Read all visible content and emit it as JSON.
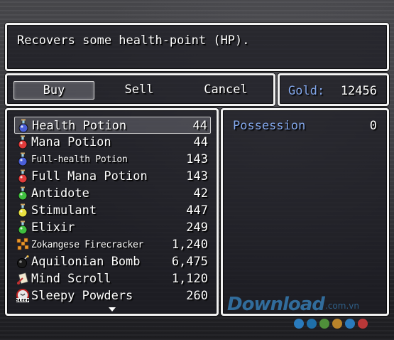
{
  "help": {
    "text": "Recovers some health-point (HP)."
  },
  "commands": [
    {
      "label": "Buy",
      "selected": true
    },
    {
      "label": "Sell",
      "selected": false
    },
    {
      "label": "Cancel",
      "selected": false
    }
  ],
  "gold": {
    "label": "Gold:",
    "value": "12456"
  },
  "items": [
    {
      "name": "Health Potion",
      "price": "44",
      "icon": "blue-potion-icon",
      "color": "#4a5fd8",
      "small": false,
      "selected": true
    },
    {
      "name": "Mana Potion",
      "price": "44",
      "icon": "red-potion-icon",
      "color": "#e03a3a",
      "small": false
    },
    {
      "name": "Full-health Potion",
      "price": "143",
      "icon": "blue-potion-icon",
      "color": "#4a5fd8",
      "small": true
    },
    {
      "name": "Full Mana Potion",
      "price": "143",
      "icon": "red-potion-icon",
      "color": "#e03a3a",
      "small": false
    },
    {
      "name": "Antidote",
      "price": "42",
      "icon": "green-potion-icon",
      "color": "#3fbf3f",
      "small": false
    },
    {
      "name": "Stimulant",
      "price": "447",
      "icon": "yellow-potion-icon",
      "color": "#e8e040",
      "small": false
    },
    {
      "name": "Elixir",
      "price": "249",
      "icon": "green-potion-icon",
      "color": "#3fbf3f",
      "small": false
    },
    {
      "name": "Zokangese Firecracker",
      "price": "1,240",
      "icon": "firecracker-icon",
      "color": "#e89a2a",
      "small": true
    },
    {
      "name": "Aquilonian Bomb",
      "price": "6,475",
      "icon": "bomb-icon",
      "color": "#222222",
      "small": false
    },
    {
      "name": "Mind Scroll",
      "price": "1,120",
      "icon": "scroll-icon",
      "color": "#c03030",
      "small": false
    },
    {
      "name": "Sleepy Powders",
      "price": "260",
      "icon": "sleep-icon",
      "color": "#c02020",
      "small": false
    }
  ],
  "status": {
    "possession_label": "Possession",
    "possession_value": "0"
  },
  "colors": {
    "system_blue": "#84a8ec",
    "window_border": "#f2f2f2"
  }
}
